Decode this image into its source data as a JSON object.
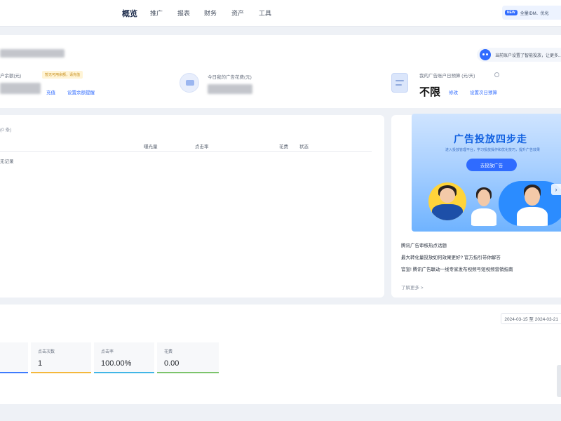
{
  "nav": {
    "items": [
      "概览",
      "推广",
      "报表",
      "财务",
      "资产",
      "工具"
    ],
    "active_index": 0,
    "pill_badge": "NEW",
    "pill_text": "全量IDM、优化"
  },
  "header": {
    "assistant_text": "当前账户设置了智能投放，让更多..."
  },
  "metrics": {
    "balance_label": "户余额(元)",
    "balance_tag": "暂无可用余额，请充值",
    "recharge_link": "充值",
    "reminder_link": "设置余额提醒",
    "today_cost_label": "今日我的广告花费(元)",
    "budget_label": "我的广告账户日预算 (元/天)",
    "budget_value": "不限",
    "modify_link": "修改",
    "tomorrow_budget_link": "设置次日预算"
  },
  "table": {
    "title": "(0 条)",
    "columns": [
      "曝光量",
      "点击率",
      "花费",
      "状态"
    ],
    "empty_text": "无记录"
  },
  "promo": {
    "banner_title": "广告投放四步走",
    "banner_subtitle": "进入投放管理平台，学习投放操作和优化技巧，提升广告效果",
    "banner_button": "去投放广告",
    "news": [
      "腾讯广告审核热点话题",
      "最大转化量投放如何效果更好? 官方指引带你解答",
      "官宣! 腾讯广告联动一线专家发布视频号短视频营销指南"
    ],
    "more_link": "了解更多 >"
  },
  "trend": {
    "date_range": "2024-03-15 至 2024-03-21",
    "stats": [
      {
        "label": "点击次数",
        "value": "1",
        "color": "#f5b83b"
      },
      {
        "label": "点击率",
        "value": "100.00%",
        "color": "#41b6e6"
      },
      {
        "label": "花费",
        "value": "0.00",
        "color": "#7cc46b"
      }
    ],
    "first_stat_color": "#3d7bff"
  },
  "colors": {
    "accent": "#2f6bff",
    "page_bg": "#eef1f6",
    "tag_bg": "#fff4d6"
  }
}
